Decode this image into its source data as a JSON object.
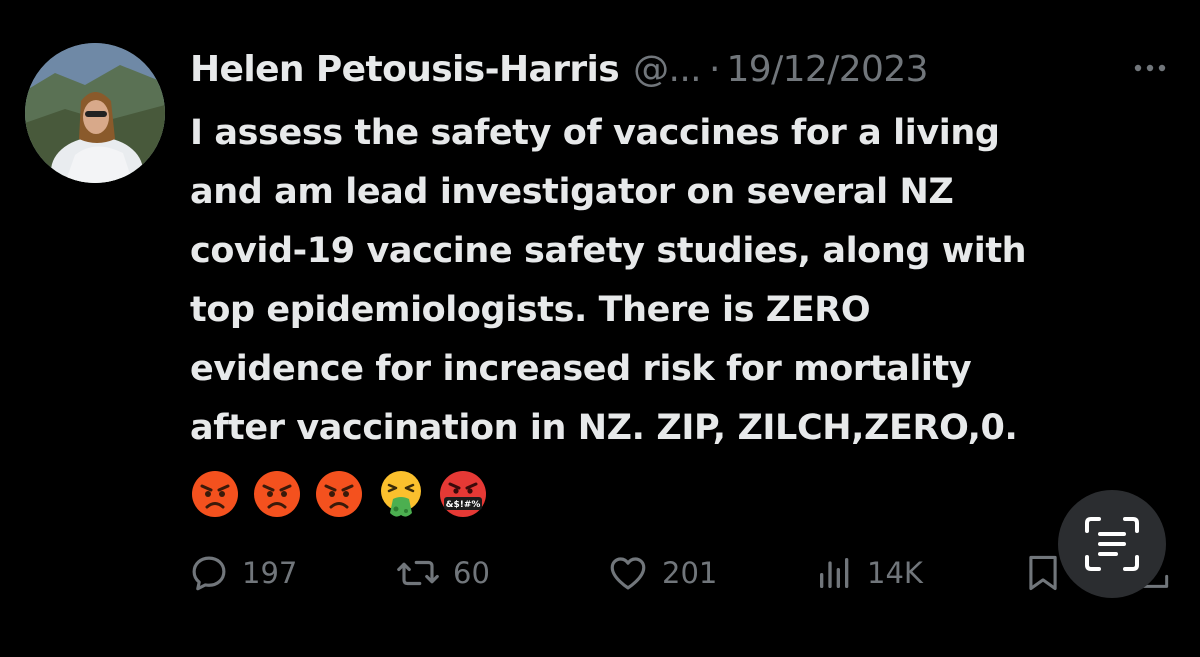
{
  "post": {
    "author_name": "Helen Petousis-Harris",
    "handle": "@...",
    "separator": "·",
    "date": "19/12/2023",
    "text_lines": [
      "I assess the safety of vaccines for a living",
      "and am lead investigator on several NZ",
      "covid-19 vaccine safety studies, along with",
      "top epidemiologists. There is ZERO",
      "evidence for increased risk for mortality",
      "after vaccination in NZ. ZIP, ZILCH,ZERO,0."
    ],
    "emojis": [
      "angry-face",
      "angry-face",
      "angry-face",
      "vomiting-face",
      "face-with-symbols-on-mouth"
    ],
    "cursing_symbols": "&$!#%"
  },
  "actions": {
    "replies": "197",
    "reposts": "60",
    "likes": "201",
    "views": "14K"
  },
  "icons": {
    "more": "more-dots-icon",
    "reply": "comment-bubble-icon",
    "repost": "repost-arrows-icon",
    "like": "heart-icon",
    "views": "bar-chart-icon",
    "bookmark": "bookmark-icon",
    "share": "share-icon",
    "scan": "text-scan-icon"
  },
  "colors": {
    "background": "#000000",
    "text_primary": "#e7e9ea",
    "text_secondary": "#71767b",
    "fab_background": "#2b2d30"
  }
}
